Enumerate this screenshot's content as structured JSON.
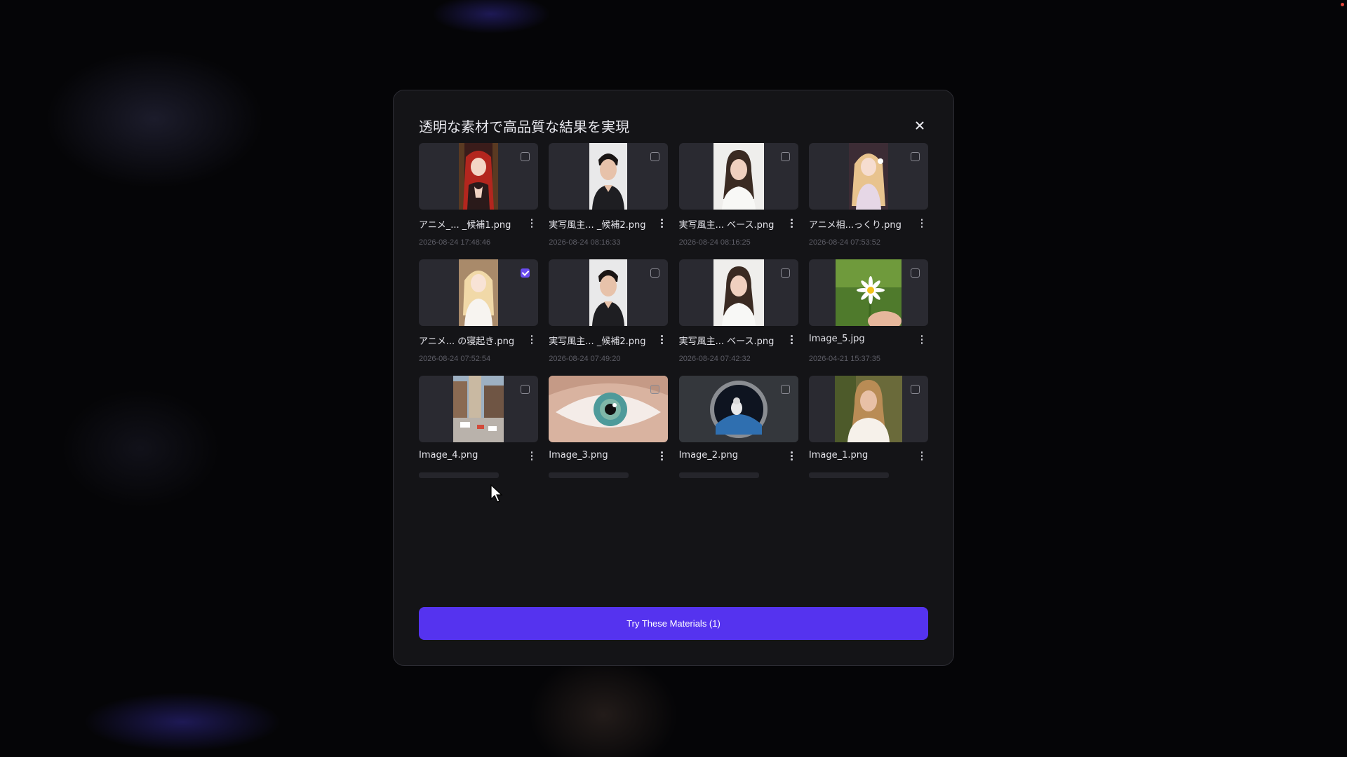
{
  "modal": {
    "title": "透明な素材で高品質な結果を実現",
    "action_button": "Try These Materials (1)"
  },
  "colors": {
    "accent": "#5533ef",
    "modal_bg": "#141417",
    "thumb_bg": "#2a2a31"
  },
  "materials": [
    {
      "name": "アニメ_...  _候補1.png",
      "date": "2026-08-24 17:48:46",
      "checked": false,
      "icon": "anime-girl-red-hair"
    },
    {
      "name": "実写風主... _候補2.png",
      "date": "2026-08-24 08:16:33",
      "checked": false,
      "icon": "man-portrait"
    },
    {
      "name": "実写風主... ベース.png",
      "date": "2026-08-24 08:16:25",
      "checked": false,
      "icon": "woman-portrait"
    },
    {
      "name": "アニメ相...っくり.png",
      "date": "2026-08-24 07:53:52",
      "checked": false,
      "icon": "anime-girl-blonde"
    },
    {
      "name": "アニメ... の寝起き.png",
      "date": "2026-08-24 07:52:54",
      "checked": true,
      "icon": "anime-girl-white"
    },
    {
      "name": "実写風主... _候補2.png",
      "date": "2026-08-24 07:49:20",
      "checked": false,
      "icon": "man-portrait"
    },
    {
      "name": "実写風主... ベース.png",
      "date": "2026-08-24 07:42:32",
      "checked": false,
      "icon": "woman-portrait"
    },
    {
      "name": "Image_5.jpg",
      "date": "2026-04-21 15:37:35",
      "checked": false,
      "icon": "daisy-flower"
    },
    {
      "name": "Image_4.png",
      "date": "",
      "checked": false,
      "icon": "city-street"
    },
    {
      "name": "Image_3.png",
      "date": "",
      "checked": false,
      "icon": "eye-closeup"
    },
    {
      "name": "Image_2.png",
      "date": "",
      "checked": false,
      "icon": "astronaut-window"
    },
    {
      "name": "Image_1.png",
      "date": "",
      "checked": false,
      "icon": "woman-blonde-portrait"
    }
  ]
}
